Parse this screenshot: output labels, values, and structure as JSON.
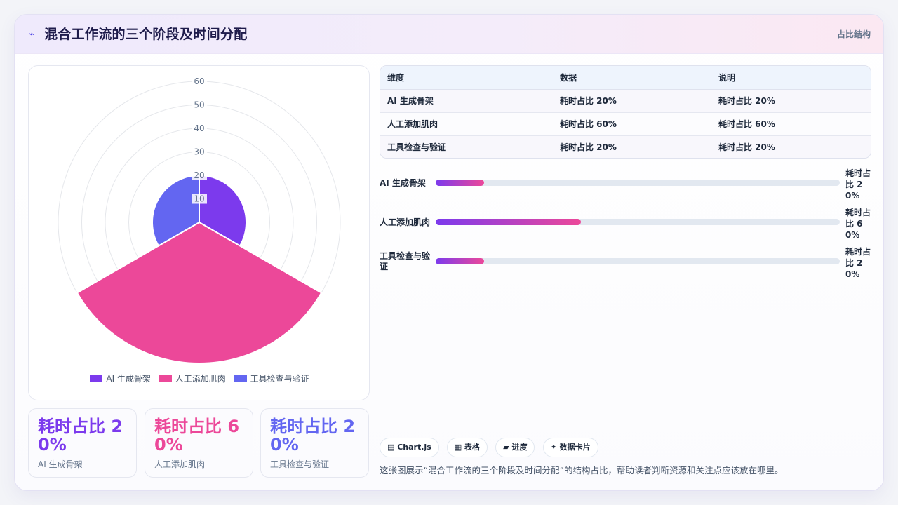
{
  "header": {
    "logo_icon": "⌁",
    "title": "混合工作流的三个阶段及时间分配",
    "tag": "占比结构"
  },
  "colors": {
    "purple": "#7c3aed",
    "pink": "#ec4899",
    "indigo": "#6366f1",
    "track": "#e2e8f0"
  },
  "chart_data": {
    "type": "polarArea",
    "categories": [
      "AI 生成骨架",
      "人工添加肌肉",
      "工具检查与验证"
    ],
    "values": [
      20,
      60,
      20
    ],
    "colors": [
      "#7c3aed",
      "#ec4899",
      "#6366f1"
    ],
    "r_ticks": [
      10,
      20,
      30,
      40,
      50,
      60
    ],
    "rlim": [
      0,
      60
    ],
    "legend": "bottom"
  },
  "kpis": [
    {
      "value": "耗时占比 20%",
      "label": "AI 生成骨架",
      "color": "#7c3aed"
    },
    {
      "value": "耗时占比 60%",
      "label": "人工添加肌肉",
      "color": "#ec4899"
    },
    {
      "value": "耗时占比 20%",
      "label": "工具检查与验证",
      "color": "#6366f1"
    }
  ],
  "table": {
    "headers": [
      "维度",
      "数据",
      "说明"
    ],
    "rows": [
      [
        "AI 生成骨架",
        "耗时占比 20%",
        "耗时占比 20%"
      ],
      [
        "人工添加肌肉",
        "耗时占比 60%",
        "耗时占比 60%"
      ],
      [
        "工具检查与验证",
        "耗时占比 20%",
        "耗时占比 20%"
      ]
    ]
  },
  "progress": [
    {
      "label": "AI 生成骨架",
      "value_text": "耗时占比 20%",
      "percent": 12
    },
    {
      "label": "人工添加肌肉",
      "value_text": "耗时占比 60%",
      "percent": 36
    },
    {
      "label": "工具检查与验证",
      "value_text": "耗时占比 20%",
      "percent": 12
    }
  ],
  "chips": [
    "▤ Chart.js",
    "▦ 表格",
    "▰ 进度",
    "✦ 数据卡片"
  ],
  "description": "这张图展示“混合工作流的三个阶段及时间分配”的结构占比，帮助读者判断资源和关注点应该放在哪里。"
}
